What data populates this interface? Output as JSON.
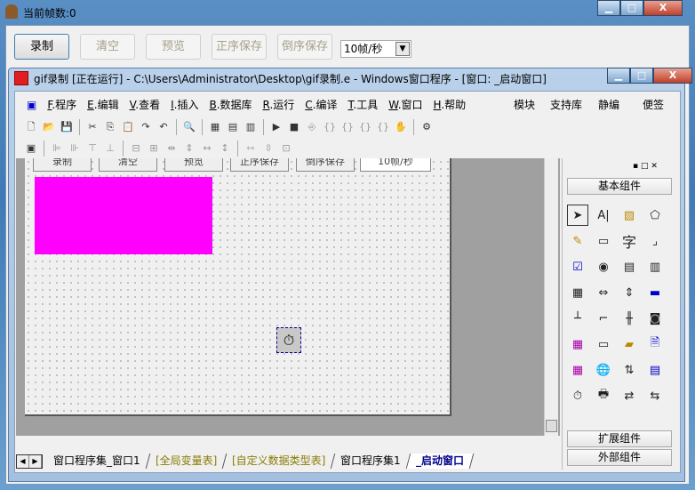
{
  "window": {
    "title": "当前帧数:0",
    "minimize": "▁",
    "maximize": "□",
    "close": "X"
  },
  "toolbar": {
    "record": "录制",
    "clear": "清空",
    "preview": "预览",
    "save_forward": "正序保存",
    "save_reverse": "倒序保存",
    "fps_value": "10帧/秒"
  },
  "ide": {
    "title": "gif录制 [正在运行] - C:\\Users\\Administrator\\Desktop\\gif录制.e - Windows窗口程序 - [窗口: _启动窗口]",
    "menu": [
      {
        "key": "F",
        "label": ".程序"
      },
      {
        "key": "E",
        "label": ".编辑"
      },
      {
        "key": "V",
        "label": ".查看"
      },
      {
        "key": "I",
        "label": ".插入"
      },
      {
        "key": "B",
        "label": ".数据库"
      },
      {
        "key": "R",
        "label": ".运行"
      },
      {
        "key": "C",
        "label": ".编译"
      },
      {
        "key": "T",
        "label": ".工具"
      },
      {
        "key": "W",
        "label": ".窗口"
      },
      {
        "key": "H",
        "label": ".帮助"
      }
    ],
    "right_menu": [
      "模块",
      "支持库",
      "静编",
      "便签"
    ],
    "form_buttons": [
      "录制",
      "清空",
      "预览",
      "正序保存",
      "倒序保存",
      "10帧/秒"
    ],
    "panel": {
      "basic": "基本组件",
      "extended": "扩展组件",
      "external": "外部组件",
      "text_icon": "字"
    },
    "tabs": [
      "窗口程序集_窗口1",
      "[全局变量表]",
      "[自定义数据类型表]",
      "窗口程序集1",
      "_启动窗口"
    ]
  },
  "colors": {
    "tab_link": "#8a7a00",
    "active_tab": "#00008b",
    "magenta": "#ff00ff"
  }
}
